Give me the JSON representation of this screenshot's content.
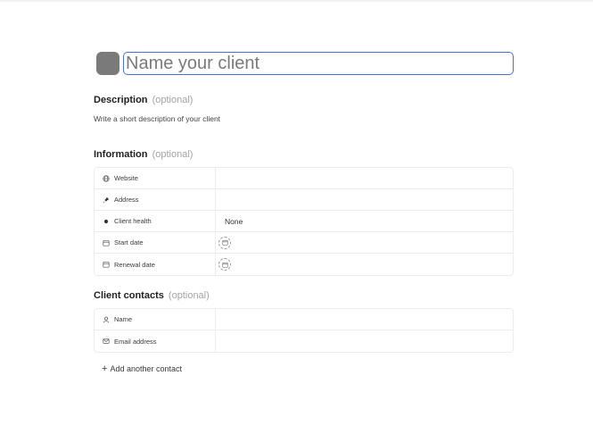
{
  "client": {
    "name_placeholder": "Name your client",
    "name_value": ""
  },
  "description": {
    "title": "Description",
    "optional": "(optional)",
    "text": "Write a short description of your client"
  },
  "information": {
    "title": "Information",
    "optional": "(optional)",
    "rows": [
      {
        "label": "Website",
        "icon": "globe-icon",
        "value": ""
      },
      {
        "label": "Address",
        "icon": "pin-icon",
        "value": ""
      },
      {
        "label": "Client health",
        "icon": "dot-icon",
        "value": "None"
      },
      {
        "label": "Start date",
        "icon": "calendar-icon",
        "value": ""
      },
      {
        "label": "Renewal date",
        "icon": "calendar-icon",
        "value": ""
      }
    ]
  },
  "contacts": {
    "title": "Client contacts",
    "optional": "(optional)",
    "rows": [
      {
        "label": "Name",
        "icon": "person-icon",
        "value": ""
      },
      {
        "label": "Email address",
        "icon": "mail-icon",
        "value": ""
      }
    ],
    "add_label": "Add another contact"
  }
}
